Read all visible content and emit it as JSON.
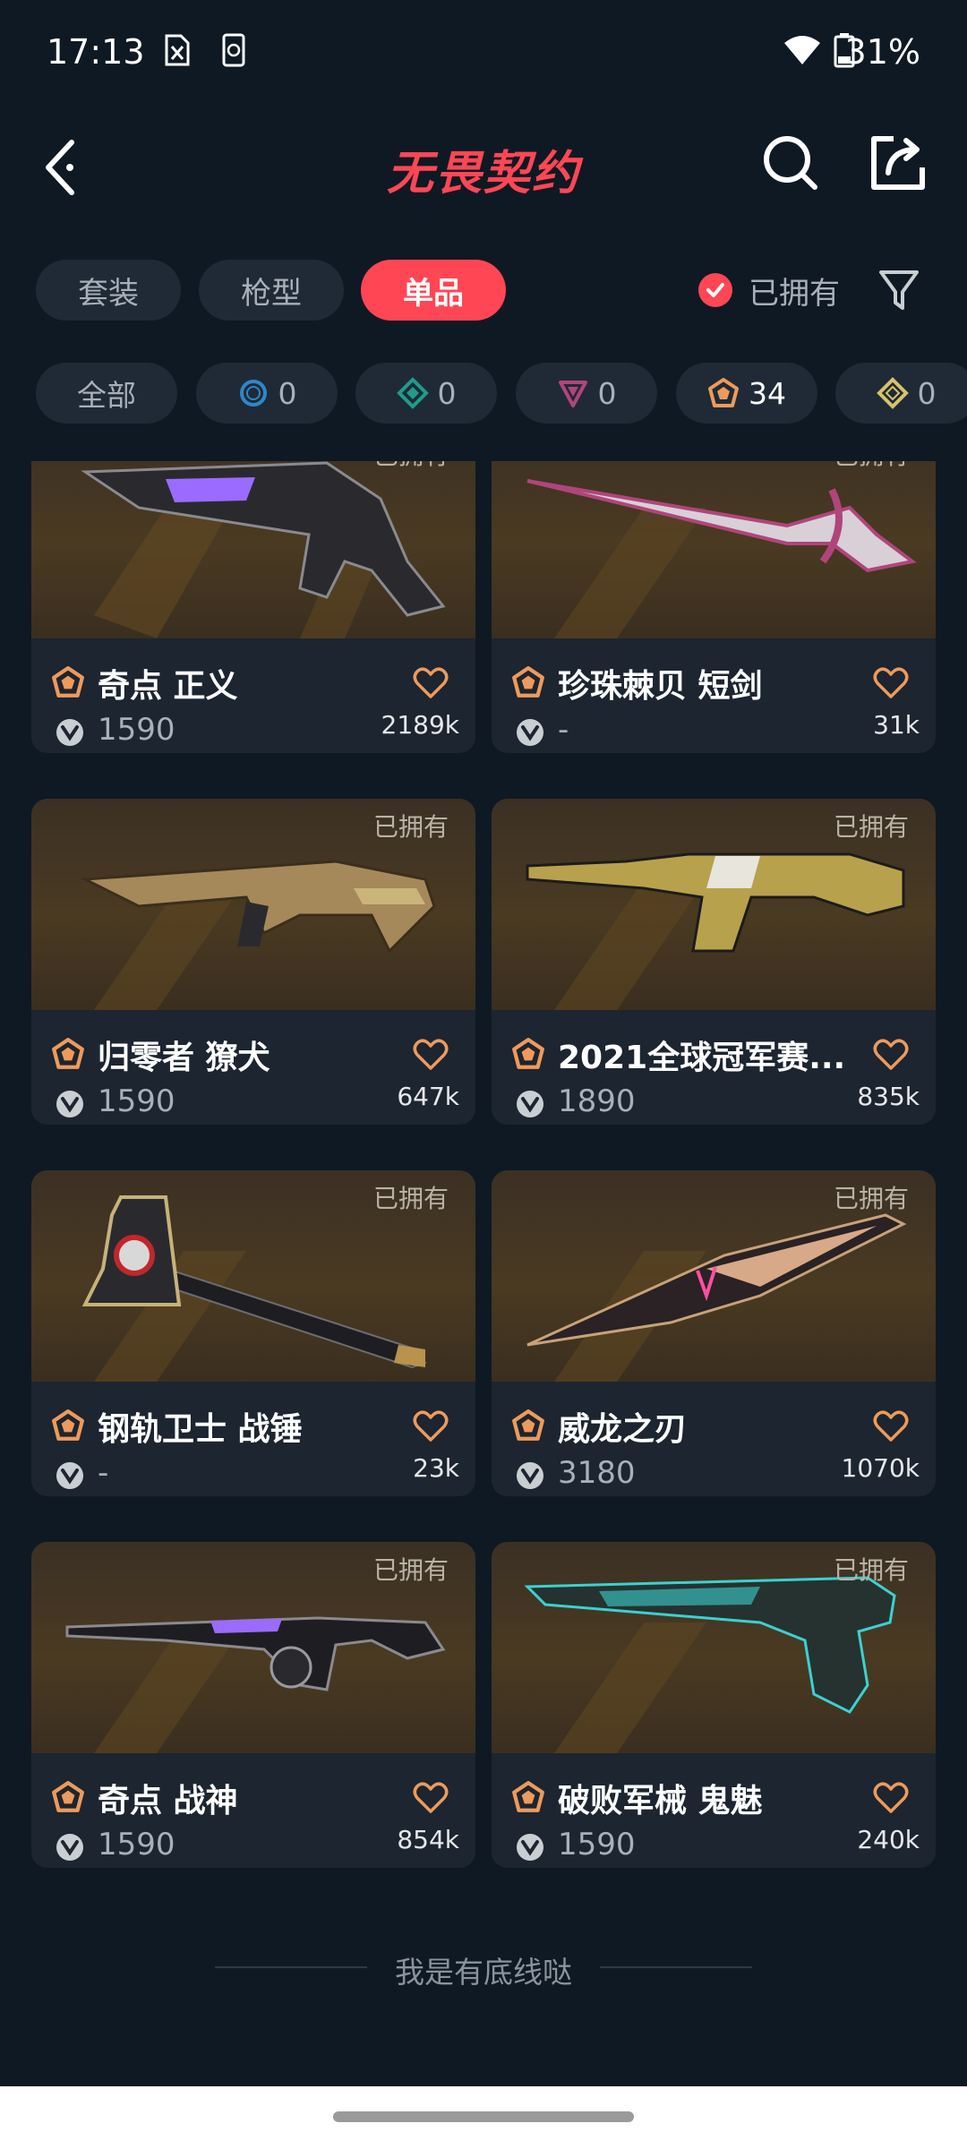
{
  "status": {
    "time": "17:13",
    "battery": "31%"
  },
  "header": {
    "title": "无畏契约"
  },
  "tabs": [
    {
      "label": "套装",
      "active": false
    },
    {
      "label": "枪型",
      "active": false
    },
    {
      "label": "单品",
      "active": true
    }
  ],
  "owned_filter": {
    "label": "已拥有",
    "checked": true
  },
  "rarity_chips": [
    {
      "label": "全部"
    },
    {
      "count": "0",
      "icon": "select-tier-icon",
      "color": "#2f86c8"
    },
    {
      "count": "0",
      "icon": "deluxe-tier-icon",
      "color": "#1f9c8a"
    },
    {
      "count": "0",
      "icon": "premium-tier-icon",
      "color": "#b0457c"
    },
    {
      "count": "34",
      "icon": "exclusive-tier-icon",
      "color": "#ee9a5b"
    },
    {
      "count": "0",
      "icon": "ultra-tier-icon",
      "color": "#d8c26a"
    }
  ],
  "items": [
    {
      "name": "奇点 正义",
      "price": "1590",
      "likes": "2189k",
      "owned": "已拥有"
    },
    {
      "name": "珍珠棘贝 短剑",
      "price": "-",
      "likes": "31k",
      "owned": "已拥有"
    },
    {
      "name": "归零者 獠犬",
      "price": "1590",
      "likes": "647k",
      "owned": "已拥有"
    },
    {
      "name": "2021全球冠军赛...",
      "price": "1890",
      "likes": "835k",
      "owned": "已拥有"
    },
    {
      "name": "钢轨卫士 战锤",
      "price": "-",
      "likes": "23k",
      "owned": "已拥有"
    },
    {
      "name": "威龙之刃",
      "price": "3180",
      "likes": "1070k",
      "owned": "已拥有"
    },
    {
      "name": "奇点 战神",
      "price": "1590",
      "likes": "854k",
      "owned": "已拥有"
    },
    {
      "name": "破败军械 鬼魅",
      "price": "1590",
      "likes": "240k",
      "owned": "已拥有"
    }
  ],
  "footer": {
    "text": "我是有底线哒"
  },
  "colors": {
    "accent": "#ff4655",
    "background": "#0f1923",
    "card": "#1c2530",
    "exclusive": "#ee9a5b"
  }
}
